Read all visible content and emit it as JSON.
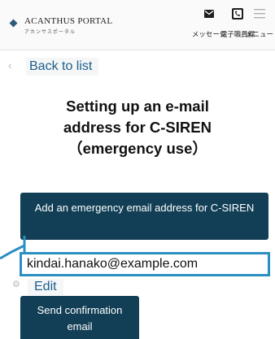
{
  "header": {
    "logo_title": "ACANTHUS PORTAL",
    "logo_subtitle": "アカンサスポータル",
    "messages_label": "メッセージ",
    "directory_label": "電子職員録",
    "menu_label": "メニュー",
    "icons": {
      "logo": "diamond-logo-icon",
      "messages": "envelope-icon",
      "directory": "phone-directory-icon",
      "menu": "hamburger-menu-icon"
    }
  },
  "navigation": {
    "back_label": "Back to list",
    "back_icon": "chevron-left-icon"
  },
  "page": {
    "title_line1": "Setting up an e-mail",
    "title_line2": "address for C-SIREN",
    "title_line3": "（emergency use）"
  },
  "actions": {
    "add_email_label": "Add an emergency email address for C-SIREN",
    "edit_label": "Edit",
    "send_confirmation_label": "Send confirmation email"
  },
  "email": {
    "value": "kindai.hanako@example.com"
  },
  "colors": {
    "button_background": "#123f56",
    "link_text": "#1d5f8a",
    "highlight_border": "#2a8fc2"
  }
}
